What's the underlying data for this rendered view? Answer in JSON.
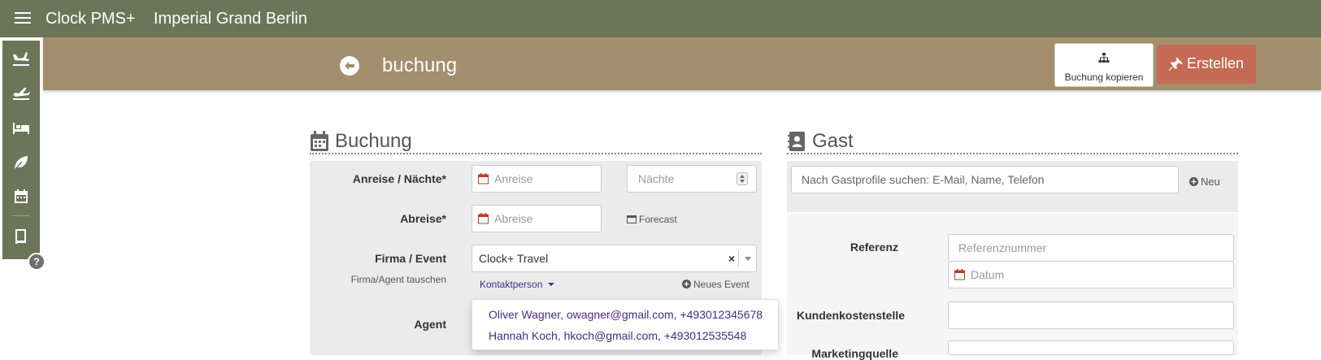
{
  "topbar": {
    "menu_icon": "hamburger-menu-icon",
    "app_name": "Clock PMS+",
    "hotel_name": "Imperial Grand Berlin"
  },
  "sidebar": {
    "items": [
      {
        "icon": "plane-arrival-icon"
      },
      {
        "icon": "plane-departure-icon"
      },
      {
        "icon": "bed-icon"
      },
      {
        "icon": "leaf-icon"
      },
      {
        "icon": "calendar-icon"
      },
      {
        "icon": "book-icon"
      }
    ],
    "help_label": "?"
  },
  "subheader": {
    "title": "buchung",
    "copy_button": "Buchung kopieren",
    "create_button": "Erstellen"
  },
  "booking": {
    "section_title": "Buchung",
    "arrival_label": "Anreise / Nächte*",
    "arrival_placeholder": "Anreise",
    "nights_placeholder": "Nächte",
    "departure_label": "Abreise*",
    "departure_placeholder": "Abreise",
    "forecast_link": "Forecast",
    "company_label": "Firma / Event",
    "company_value": "Clock+ Travel",
    "company_clear": "×",
    "swap_link": "Firma/Agent tauschen",
    "contact_link": "Kontaktperson",
    "new_event_link": "Neues Event",
    "agent_label": "Agent",
    "contacts": [
      "Oliver Wagner, owagner@gmail.com, +493012345678",
      "Hannah Koch, hkoch@gmail.com, +493012535548"
    ]
  },
  "guest": {
    "section_title": "Gast",
    "search_placeholder": "Nach Gastprofile suchen: E-Mail, Name, Telefon",
    "new_link": "Neu",
    "reference_label": "Referenz",
    "reference_placeholder": "Referenznummer",
    "date_placeholder": "Datum",
    "cost_center_label": "Kundenkostenstelle",
    "marketing_label": "Marketingquelle"
  },
  "colors": {
    "topbar": "#6d7558",
    "subheader": "#a38f6e",
    "create_button": "#c46a55",
    "link": "#4a2a84"
  }
}
